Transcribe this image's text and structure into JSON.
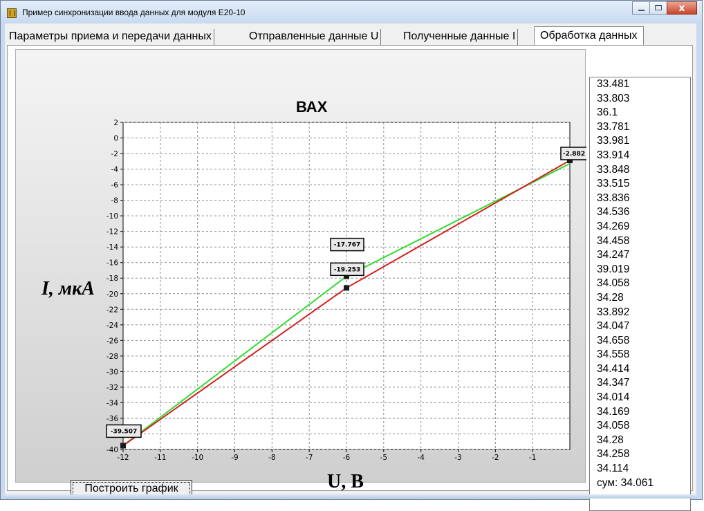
{
  "window": {
    "title": "Пример синхронизации ввода данных для модуля E20-10",
    "close_glyph": "x"
  },
  "tabs": [
    {
      "label": "Параметры приема и передачи данных"
    },
    {
      "label": "Отправленные данные U"
    },
    {
      "label": "Полученные данные I"
    },
    {
      "label": "Обработка данных",
      "active": true
    }
  ],
  "chart_data": {
    "type": "line",
    "title": "ВАХ",
    "xlabel": "U, В",
    "ylabel": "I, мкА",
    "xlim": [
      -12,
      0
    ],
    "ylim": [
      -40,
      2
    ],
    "x_ticks": [
      -12,
      -11,
      -10,
      -9,
      -8,
      -7,
      -6,
      -5,
      -4,
      -3,
      -2,
      -1
    ],
    "y_ticks": [
      2,
      0,
      -2,
      -4,
      -6,
      -8,
      -10,
      -12,
      -14,
      -16,
      -18,
      -20,
      -22,
      -24,
      -26,
      -28,
      -30,
      -32,
      -34,
      -36,
      -38,
      -40
    ],
    "grid": true,
    "series": [
      {
        "color": "#2fdc2f",
        "x": [
          -12,
          -6,
          0
        ],
        "y": [
          -39.5,
          -17.767,
          -3.3
        ]
      },
      {
        "color": "#d42020",
        "x": [
          -12,
          -6,
          0
        ],
        "y": [
          -39.507,
          -19.253,
          -2.882
        ]
      }
    ],
    "annotations": [
      {
        "x": -12,
        "y": -39.507,
        "text": "-39.507"
      },
      {
        "x": -6,
        "y": -17.767,
        "text": "-17.767"
      },
      {
        "x": -6,
        "y": -19.253,
        "text": "-19.253"
      },
      {
        "x": 0,
        "y": -2.882,
        "text": "-2.882"
      }
    ]
  },
  "build_button": {
    "label": "Построить график"
  },
  "listbox": {
    "items": [
      "33.481",
      "33.803",
      "36.1",
      "33.781",
      "33.981",
      "33.914",
      "33.848",
      "33.515",
      "33.836",
      "34.536",
      "34.269",
      "34.458",
      "34.247",
      "39.019",
      "34.058",
      "34.28",
      "33.892",
      "34.047",
      "34.658",
      "34.558",
      "34.414",
      "34.347",
      "34.014",
      "34.169",
      "34.058",
      "34.28",
      "34.258",
      "34.114",
      "сум: 34.061"
    ]
  }
}
